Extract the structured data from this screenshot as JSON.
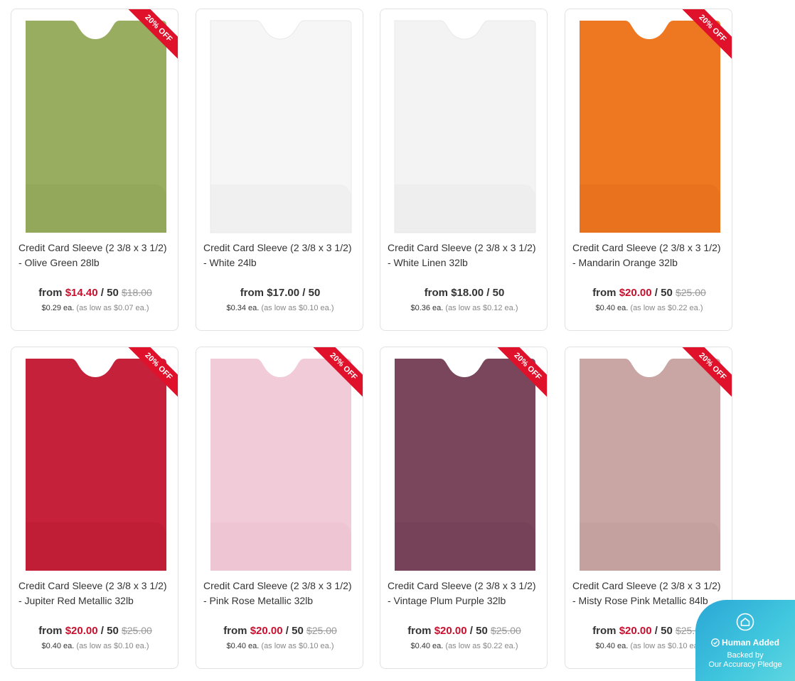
{
  "products": [
    {
      "title": "Credit Card Sleeve (2 3/8 x 3 1/2) - Olive Green 28lb",
      "from_label": "from",
      "price": "$14.40",
      "unit": "/ 50",
      "was": "$18.00",
      "each": "$0.29 ea.",
      "low": "(as low as $0.07 ea.)",
      "badge": "20% OFF",
      "color": "#98ad5f",
      "shade": "#8aa054"
    },
    {
      "title": "Credit Card Sleeve (2 3/8 x 3 1/2) - White 24lb",
      "from_label": "from",
      "price": "$17.00",
      "unit": "/ 50",
      "was": "",
      "each": "$0.34 ea.",
      "low": "(as low as $0.10 ea.)",
      "badge": "",
      "color": "#f6f6f6",
      "shade": "#e6e6e6"
    },
    {
      "title": "Credit Card Sleeve (2 3/8 x 3 1/2) - White Linen 32lb",
      "from_label": "from",
      "price": "$18.00",
      "unit": "/ 50",
      "was": "",
      "each": "$0.36 ea.",
      "low": "(as low as $0.12 ea.)",
      "badge": "",
      "color": "#f3f3f3",
      "shade": "#e4e4e4"
    },
    {
      "title": "Credit Card Sleeve (2 3/8 x 3 1/2) - Mandarin Orange 32lb",
      "from_label": "from",
      "price": "$20.00",
      "unit": "/ 50",
      "was": "$25.00",
      "each": "$0.40 ea.",
      "low": "(as low as $0.22 ea.)",
      "badge": "20% OFF",
      "color": "#ee7722",
      "shade": "#e06a18"
    },
    {
      "title": "Credit Card Sleeve (2 3/8 x 3 1/2) - Jupiter Red Metallic 32lb",
      "from_label": "from",
      "price": "$20.00",
      "unit": "/ 50",
      "was": "$25.00",
      "each": "$0.40 ea.",
      "low": "(as low as $0.10 ea.)",
      "badge": "20% OFF",
      "color": "#c6213a",
      "shade": "#b31a32"
    },
    {
      "title": "Credit Card Sleeve (2 3/8 x 3 1/2) - Pink Rose Metallic 32lb",
      "from_label": "from",
      "price": "$20.00",
      "unit": "/ 50",
      "was": "$25.00",
      "each": "$0.40 ea.",
      "low": "(as low as $0.10 ea.)",
      "badge": "20% OFF",
      "color": "#f1cbd8",
      "shade": "#e9bccb"
    },
    {
      "title": "Credit Card Sleeve (2 3/8 x 3 1/2) - Vintage Plum Purple 32lb",
      "from_label": "from",
      "price": "$20.00",
      "unit": "/ 50",
      "was": "$25.00",
      "each": "$0.40 ea.",
      "low": "(as low as $0.22 ea.)",
      "badge": "20% OFF",
      "color": "#7a465c",
      "shade": "#6e3d52"
    },
    {
      "title": "Credit Card Sleeve (2 3/8 x 3 1/2) - Misty Rose Pink Metallic 84lb",
      "from_label": "from",
      "price": "$20.00",
      "unit": "/ 50",
      "was": "$25.00",
      "each": "$0.40 ea.",
      "low": "(as low as $0.10 ea.)",
      "badge": "20% OFF",
      "color": "#c9a6a4",
      "shade": "#bb9896"
    }
  ],
  "pledge": {
    "icon": "home-shield-icon",
    "headline": "Human Added",
    "line1": "Backed by",
    "line2": "Our Accuracy Pledge"
  }
}
